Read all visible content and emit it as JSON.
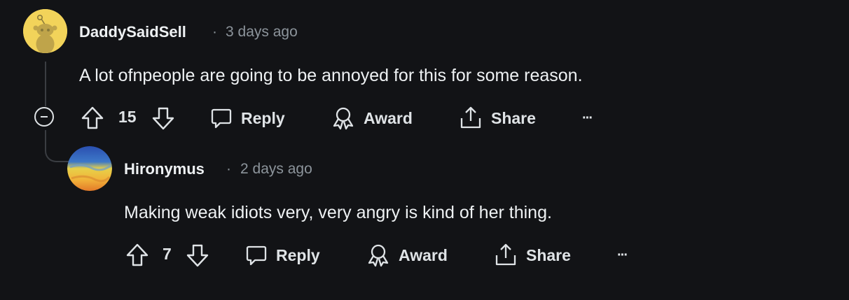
{
  "comments": [
    {
      "author": "DaddySaidSell",
      "separator": "·",
      "time": "3 days ago",
      "text": "A lot ofnpeople are going to be annoyed for this for some reason.",
      "votes": "15",
      "actions": {
        "reply": "Reply",
        "award": "Award",
        "share": "Share",
        "more": "···"
      }
    },
    {
      "author": "Hironymus",
      "separator": "·",
      "time": "2 days ago",
      "text": "Making weak idiots very, very angry is kind of her thing.",
      "votes": "7",
      "actions": {
        "reply": "Reply",
        "award": "Award",
        "share": "Share",
        "more": "···"
      }
    }
  ],
  "icons": {
    "collapse": "minus-circle-icon",
    "upvote": "arrow-up-icon",
    "downvote": "arrow-down-icon",
    "reply": "speech-bubble-icon",
    "award": "award-ribbon-icon",
    "share": "share-upload-icon",
    "more": "ellipsis-icon"
  },
  "colors": {
    "background": "#121316",
    "text": "#eef1f3",
    "meta": "#8c949b",
    "avatar_snoo": "#f2d35a"
  }
}
